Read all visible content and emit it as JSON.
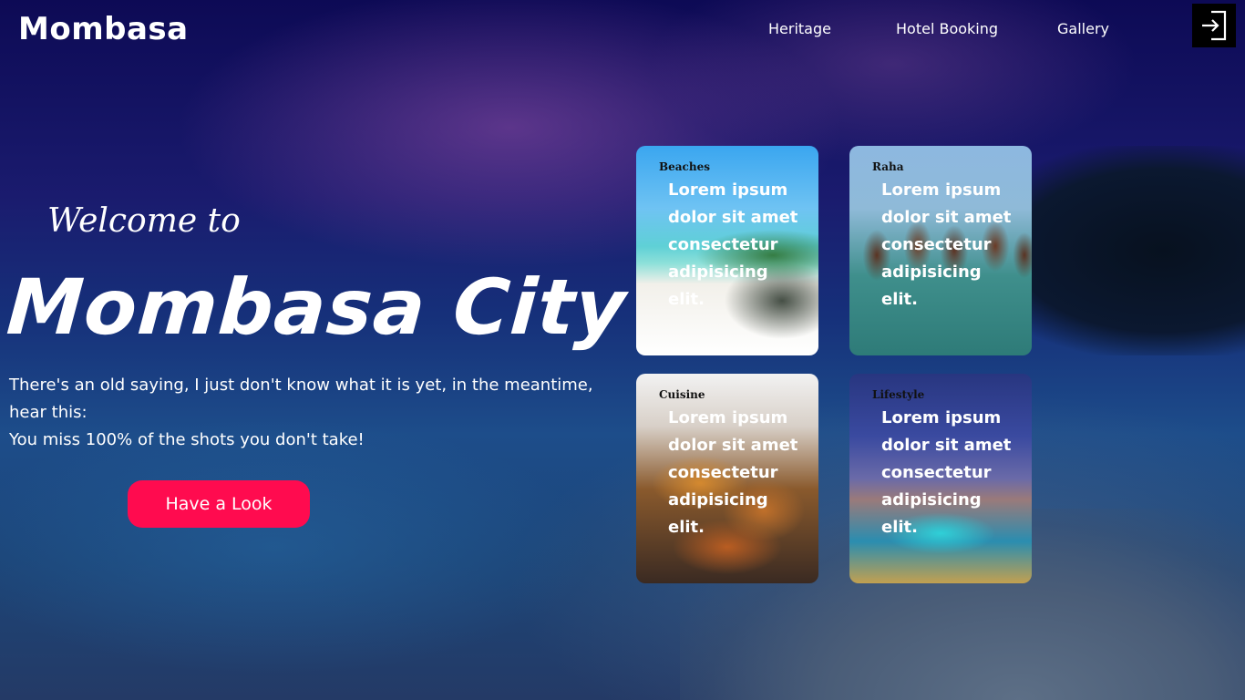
{
  "brand": "Mombasa",
  "nav": {
    "items": [
      {
        "label": "Heritage"
      },
      {
        "label": "Hotel Booking"
      },
      {
        "label": "Gallery"
      }
    ],
    "login_icon": "sign-in-icon"
  },
  "hero": {
    "welcome": "Welcome to",
    "title": "Mombasa City",
    "tagline_line1": "There's an old saying, I just don't know what it is yet, in the meantime, hear this:",
    "tagline_line2": "You miss 100% of the shots you don't take!",
    "cta_label": "Have a Look"
  },
  "cards": [
    {
      "label": "Beaches",
      "body": "Lorem ipsum dolor sit amet consectetur adipisicing elit."
    },
    {
      "label": "Raha",
      "body": "Lorem ipsum dolor sit amet consectetur adipisicing elit."
    },
    {
      "label": "Cuisine",
      "body": "Lorem ipsum dolor sit amet consectetur adipisicing elit."
    },
    {
      "label": "Lifestyle",
      "body": "Lorem ipsum dolor sit amet consectetur adipisicing elit."
    }
  ],
  "colors": {
    "accent": "#ff0b4f",
    "login_bg": "#000000"
  }
}
